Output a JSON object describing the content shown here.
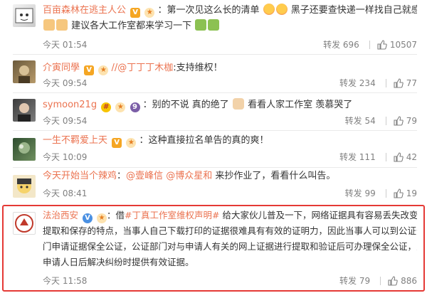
{
  "comments": [
    {
      "username": "百亩森林在逃主人公",
      "text_parts": [
        "：第一次见这么长的清单",
        "黑子还要查快递一样找自己就感觉搞笑",
        "建议各大工作室都来学习一下"
      ],
      "time": "今天 01:54",
      "repost": "转发 696",
      "likes": "10507"
    },
    {
      "username": "介寅同學",
      "mention": "//@丁丁丁木枷",
      "text": ":支持维权！",
      "time": "今天 09:54",
      "repost": "转发 234",
      "likes": "77"
    },
    {
      "username": "symoon21g",
      "text_parts": [
        "：别的不说 真的绝了",
        "看看人家工作室 羡慕哭了"
      ],
      "time": "今天 09:54",
      "repost": "转发 54",
      "likes": "79"
    },
    {
      "username": "一生不羁爱上天",
      "text": "：这种直接拉名单告的真的爽！",
      "time": "今天 10:09",
      "repost": "转发 111",
      "likes": "42"
    },
    {
      "username": "今天开始当个辣鸡",
      "mention1": "@壹峰信",
      "mention2": "@博众星和",
      "text": "来抄作业了，看看什么叫告。",
      "time": "今天 08:41",
      "repost": "转发 99",
      "likes": "19"
    },
    {
      "username": "法治西安",
      "prefix": "：借",
      "hashtag": "#丁真工作室维权声明#",
      "lines": [
        "给大家伙儿普及一下，网络证据具有容易丢失改变、不易",
        "提取和保存的特点，当事人自己下载打印的证据很难具有有效的证明力，因此当事人可以到公证部",
        "门申请证据保全公证，公证部门对与申请人有关的网上证据进行提取和验证后可办理保全公证，为",
        "申请人日后解决纠纷时提供有效证据。"
      ],
      "time": "今天 11:58",
      "repost": "转发 79",
      "likes": "886"
    }
  ],
  "colors": {
    "accent": "#eb7350",
    "highlight": "#e53935",
    "meta": "#808080"
  }
}
